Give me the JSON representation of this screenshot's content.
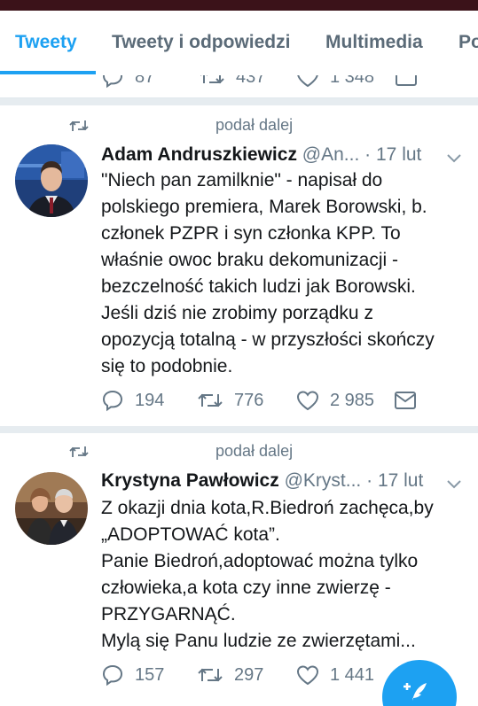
{
  "tabs": [
    {
      "label": "Tweety",
      "active": true
    },
    {
      "label": "Tweety i odpowiedzi",
      "active": false
    },
    {
      "label": "Multimedia",
      "active": false
    },
    {
      "label": "Po",
      "active": false
    }
  ],
  "colors": {
    "accent": "#1da1f2",
    "muted": "#657786",
    "text": "#14171a",
    "divider": "#e6ecf0",
    "status_bar": "#3b1219"
  },
  "previous_tweet_actions": {
    "replies": "87",
    "retweets": "437",
    "likes": "1 348"
  },
  "tweets": [
    {
      "retweet_label": "podał dalej",
      "name": "Adam Andruszkiewicz",
      "handle": "@An...",
      "dot": "·",
      "time": "17 lut",
      "lines": [
        "\"Niech pan zamilknie\" - napisał do",
        "polskiego premiera, Marek Borowski, b.",
        "członek PZPR i syn członka KPP. To",
        "właśnie owoc braku dekomunizacji -",
        "bezczelność takich ludzi jak Borowski.",
        "Jeśli dziś nie zrobimy porządku z",
        "opozycją totalną - w przyszłości skończy",
        "się to podobnie."
      ],
      "replies": "194",
      "retweets": "776",
      "likes": "2 985"
    },
    {
      "retweet_label": "podał dalej",
      "name": "Krystyna Pawłowicz",
      "handle": "@Kryst...",
      "dot": "·",
      "time": "17 lut",
      "lines": [
        "Z okazji dnia kota,R.Biedroń zachęca,by",
        "„ADOPTOWAĆ  kota”.",
        "Panie Biedroń,adoptować można tylko",
        "człowieka,a kota czy inne zwierzę -",
        "PRZYGARNĄĆ.",
        "Mylą się Panu ludzie ze zwierzętami..."
      ],
      "replies": "157",
      "retweets": "297",
      "likes": "1 441"
    }
  ],
  "icons": {
    "reply": "reply-icon",
    "retweet": "retweet-icon",
    "like": "heart-icon",
    "message": "message-icon",
    "more": "chevron-down-icon",
    "compose": "compose-tweet-icon"
  }
}
